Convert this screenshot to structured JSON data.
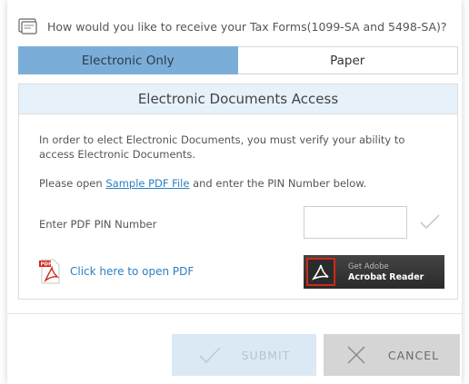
{
  "question": {
    "icon": "tax-form-icon",
    "text": "How would you like to receive your Tax Forms(1099-SA and 5498-SA)?"
  },
  "delivery_toggle": {
    "options": [
      {
        "label": "Electronic Only",
        "selected": true
      },
      {
        "label": "Paper",
        "selected": false
      }
    ]
  },
  "panel": {
    "title": "Electronic Documents Access",
    "instructions": "In order to elect Electronic Documents, you must verify your ability to access Electronic Documents.",
    "open_prefix": "Please open ",
    "sample_link": "Sample PDF File",
    "open_suffix": " and enter the PIN Number below.",
    "pin_label": "Enter PDF PIN Number",
    "pin_value": "",
    "pdf_link_text": "Click here to open PDF",
    "adobe": {
      "line1": "Get Adobe",
      "line2": "Acrobat Reader"
    }
  },
  "actions": {
    "submit_label": "SUBMIT",
    "cancel_label": "CANCEL"
  },
  "colors": {
    "selected_toggle": "#7aaed9",
    "panel_header": "#e6f1fa",
    "link": "#2a7fc4",
    "submit_disabled": "#dbe9f5",
    "cancel": "#d5d5d5",
    "adobe_red": "#d0281b"
  }
}
